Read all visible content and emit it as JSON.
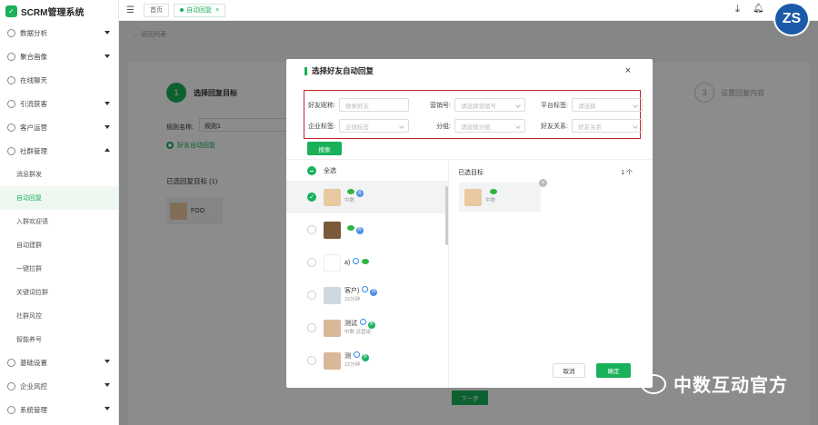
{
  "app": {
    "title": "SCRM管理系统"
  },
  "sidebar": {
    "items": [
      {
        "label": "数据分析",
        "icon": "chart-icon",
        "arrow": "down"
      },
      {
        "label": "聚合画像",
        "icon": "portrait-icon",
        "arrow": "down"
      },
      {
        "label": "在线聊天",
        "icon": "chat-icon",
        "arrow": ""
      },
      {
        "label": "引流获客",
        "icon": "funnel-icon",
        "arrow": "down"
      },
      {
        "label": "客户运营",
        "icon": "user-icon",
        "arrow": "down"
      },
      {
        "label": "社群管理",
        "icon": "group-icon",
        "arrow": "up"
      },
      {
        "label": "消息群发",
        "sub": true
      },
      {
        "label": "自动回复",
        "sub": true,
        "active": true
      },
      {
        "label": "入群欢迎语",
        "sub": true
      },
      {
        "label": "自动建群",
        "sub": true
      },
      {
        "label": "一键拉群",
        "sub": true
      },
      {
        "label": "关键词拉群",
        "sub": true
      },
      {
        "label": "社群风控",
        "sub": true
      },
      {
        "label": "智能养号",
        "sub": true
      },
      {
        "label": "基础设置",
        "icon": "settings-icon",
        "arrow": "down"
      },
      {
        "label": "企业风控",
        "icon": "shield-icon",
        "arrow": "down"
      },
      {
        "label": "系统管理",
        "icon": "gear-icon",
        "arrow": "down"
      }
    ]
  },
  "topbar": {
    "tabs": [
      {
        "label": "首页"
      },
      {
        "label": "自动回复",
        "close": "×"
      }
    ]
  },
  "background": {
    "back": "← 返回列表",
    "step1_num": "1",
    "step1": "选择回复目标",
    "step3_num": "3",
    "step3": "设置回复内容",
    "rule_label": "规则名称:",
    "rule_value": "规则1",
    "radio1": "好友自动回复",
    "section": "已选回复目标 (1)",
    "foo": "FOO",
    "next": "下一步"
  },
  "modal": {
    "title": "选择好友自动回复",
    "close": "×",
    "filters": {
      "nickname_label": "好友昵称:",
      "nickname_placeholder": "搜索好友",
      "account_label": "营销号:",
      "account_placeholder": "请选择营销号",
      "platform_label": "平台标签:",
      "platform_placeholder": "请选择",
      "corp_label": "企业标签:",
      "corp_placeholder": "企微标签",
      "group_label": "分组:",
      "group_placeholder": "请选择分组",
      "relation_label": "好友关系:",
      "relation_placeholder": "好友关系"
    },
    "search": "搜索",
    "select_all": "全选",
    "selected_title": "已选目标",
    "selected_count": "1 个",
    "list": [
      {
        "name": "",
        "sub": "中数",
        "checked": true
      },
      {
        "name": "",
        "sub": "",
        "checked": false
      },
      {
        "name": "a)",
        "sub": "",
        "checked": false
      },
      {
        "name": "客户)",
        "sub": "22分钟",
        "checked": false
      },
      {
        "name": "测试",
        "sub": "中数 运营组",
        "checked": false
      },
      {
        "name": "测",
        "sub": "22分钟",
        "checked": false
      }
    ],
    "selected_item_sub": "中数",
    "cancel": "取消",
    "ok": "确定"
  },
  "watermark": {
    "text": "中数互动官方"
  },
  "brand": {
    "logo": "ZS"
  }
}
